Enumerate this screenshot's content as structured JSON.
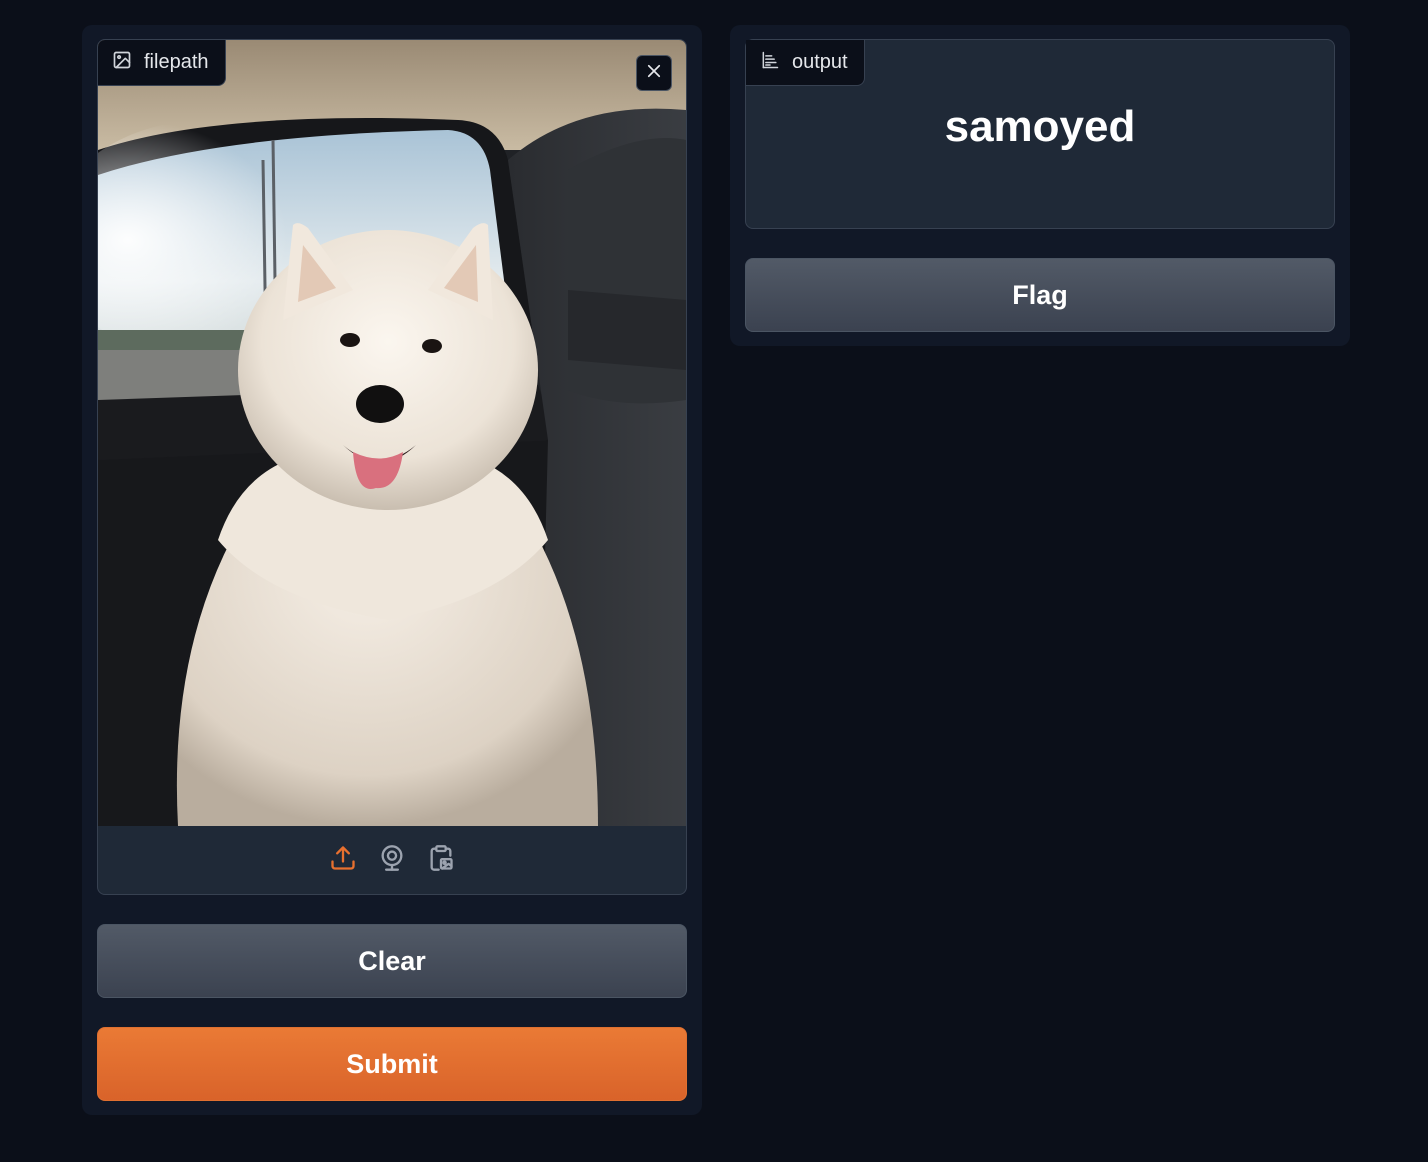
{
  "input": {
    "label": "filepath",
    "label_icon": "image-icon",
    "close_icon": "close-icon",
    "image_subject": "white samoyed dog sitting in car seat",
    "sources": [
      {
        "name": "upload-icon",
        "active": true
      },
      {
        "name": "webcam-icon",
        "active": false
      },
      {
        "name": "clipboard-icon",
        "active": false
      }
    ]
  },
  "output": {
    "label": "output",
    "label_icon": "bar-chart-icon",
    "value": "samoyed"
  },
  "buttons": {
    "clear": "Clear",
    "submit": "Submit",
    "flag": "Flag"
  },
  "colors": {
    "background": "#0b0f19",
    "panel": "#111827",
    "block": "#1f2937",
    "accent": "#e8702f",
    "secondary_button": "#4b5563"
  }
}
